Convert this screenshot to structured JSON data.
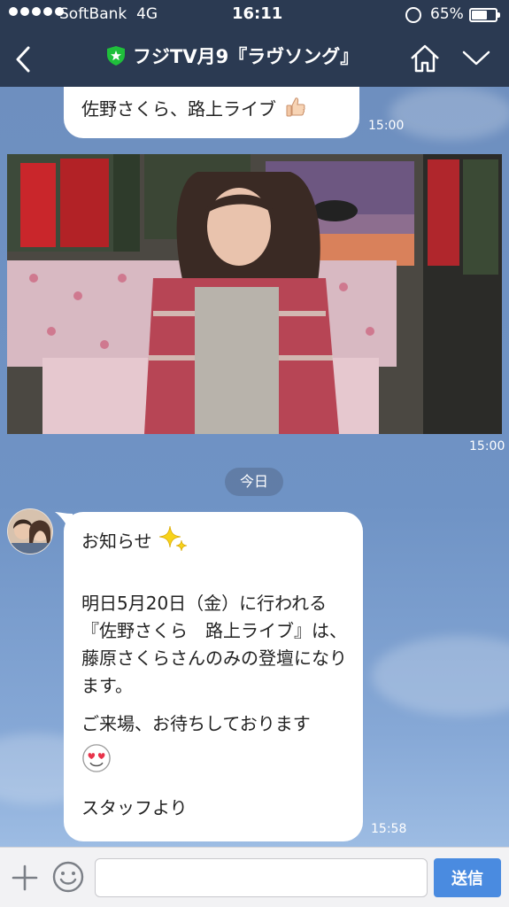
{
  "status_bar": {
    "carrier": "SoftBank",
    "network": "4G",
    "time": "16:11",
    "battery_pct_label": "65%",
    "battery_level": 0.65,
    "icons": [
      "signal-dots-icon",
      "rotation-lock-icon",
      "battery-icon"
    ]
  },
  "nav": {
    "title": "フジTV月9『ラヴソング』",
    "icons": [
      "back-chevron-icon",
      "official-shield-icon",
      "home-icon",
      "menu-chevron-down-icon"
    ]
  },
  "messages": [
    {
      "type": "text",
      "text": "佐野さくら、路上ライブ",
      "emoji": "thumbs-up",
      "time": "15:00"
    },
    {
      "type": "video",
      "description_icon": "video-thumbnail",
      "time": "15:00"
    },
    {
      "type": "date_separator",
      "label": "今日"
    },
    {
      "type": "text",
      "sender_avatar": "avatar-icon",
      "lines": [
        "お知らせ",
        "",
        "明日5月20日（金）に行われる『佐野さくら　路上ライブ』は、藤原さくらさんのみの登壇になります。",
        "",
        "ご来場、お待ちしております",
        "",
        "",
        "スタッフより"
      ],
      "emojis": [
        "sparkles",
        "heart-eyes-face"
      ],
      "time": "15:58"
    }
  ],
  "input_bar": {
    "value": "",
    "placeholder": "",
    "send_label": "送信",
    "icons": [
      "plus-icon",
      "smiley-icon"
    ]
  },
  "colors": {
    "header_bg": "#2b3a52",
    "chat_bg": "#6f93c3",
    "send_button": "#4a8be0",
    "official_badge": "#1fbf3b"
  }
}
